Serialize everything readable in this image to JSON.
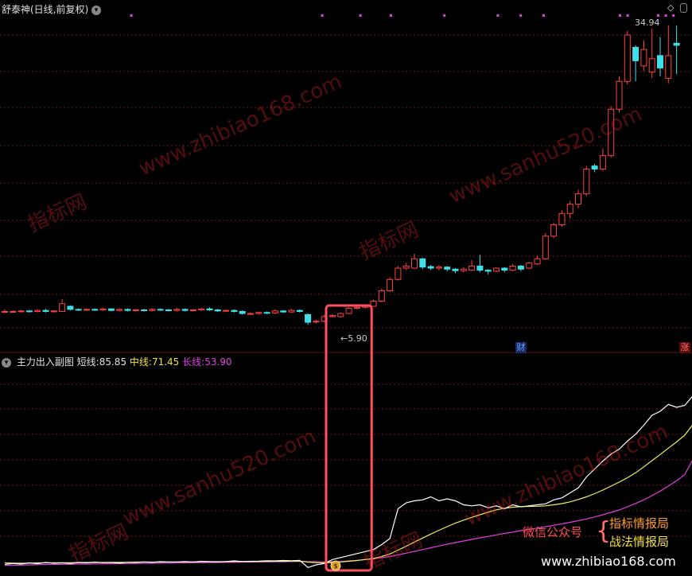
{
  "main_panel": {
    "title": "舒泰神(日线,前复权)",
    "price_high_label": "34.94",
    "price_low_label": "5.90",
    "event_badge_cai": "财",
    "event_badge_zhang": "涨"
  },
  "indicator_panel": {
    "title": "主力出入副图",
    "short_label": "短线:",
    "short_value": "85.85",
    "mid_label": "中线:",
    "mid_value": "71.45",
    "long_label": "长线:",
    "long_value": "53.90"
  },
  "watermarks": {
    "url1": "www.zhibiao168.com",
    "url2": "www.sanhu520.com",
    "site": "指标网"
  },
  "promo": {
    "left": "微信公众号",
    "right_line1": "指标情报局",
    "right_line2": "战法情报局",
    "bottom_url": "www.zhibiao168.com"
  },
  "colors": {
    "up": "#ff4040",
    "down": "#40e0e8",
    "short": "#ffffff",
    "mid": "#f0f060",
    "long": "#e040e0",
    "highlight": "#ff5060"
  },
  "chart_data": {
    "type": "candlestick",
    "price_range": [
      5.0,
      36.0
    ],
    "candles": [
      {
        "o": 7.2,
        "c": 7.2,
        "h": 7.4,
        "l": 7.05
      },
      {
        "o": 7.2,
        "c": 7.2,
        "h": 7.3,
        "l": 7.1
      },
      {
        "o": 7.2,
        "c": 7.25,
        "h": 7.35,
        "l": 7.1
      },
      {
        "o": 7.25,
        "c": 7.2,
        "h": 7.35,
        "l": 7.1
      },
      {
        "o": 7.2,
        "c": 7.3,
        "h": 7.4,
        "l": 7.1
      },
      {
        "o": 7.3,
        "c": 7.2,
        "h": 7.45,
        "l": 7.1
      },
      {
        "o": 7.2,
        "c": 7.25,
        "h": 7.35,
        "l": 7.1
      },
      {
        "o": 7.2,
        "c": 7.95,
        "h": 8.4,
        "l": 7.15
      },
      {
        "o": 7.7,
        "c": 7.4,
        "h": 7.8,
        "l": 7.3
      },
      {
        "o": 7.4,
        "c": 7.35,
        "h": 7.5,
        "l": 7.25
      },
      {
        "o": 7.35,
        "c": 7.4,
        "h": 7.5,
        "l": 7.25
      },
      {
        "o": 7.4,
        "c": 7.35,
        "h": 7.5,
        "l": 7.25
      },
      {
        "o": 7.35,
        "c": 7.45,
        "h": 7.55,
        "l": 7.25
      },
      {
        "o": 7.45,
        "c": 7.3,
        "h": 7.5,
        "l": 7.2
      },
      {
        "o": 7.3,
        "c": 7.4,
        "h": 7.5,
        "l": 7.2
      },
      {
        "o": 7.4,
        "c": 7.3,
        "h": 7.5,
        "l": 7.2
      },
      {
        "o": 7.3,
        "c": 7.35,
        "h": 7.45,
        "l": 7.2
      },
      {
        "o": 7.35,
        "c": 7.3,
        "h": 7.45,
        "l": 7.2
      },
      {
        "o": 7.3,
        "c": 7.4,
        "h": 7.5,
        "l": 7.2
      },
      {
        "o": 7.4,
        "c": 7.35,
        "h": 7.5,
        "l": 7.25
      },
      {
        "o": 7.35,
        "c": 7.3,
        "h": 7.45,
        "l": 7.2
      },
      {
        "o": 7.3,
        "c": 7.4,
        "h": 7.55,
        "l": 7.2
      },
      {
        "o": 7.4,
        "c": 7.3,
        "h": 7.5,
        "l": 7.2
      },
      {
        "o": 7.3,
        "c": 7.35,
        "h": 7.45,
        "l": 7.2
      },
      {
        "o": 7.35,
        "c": 7.45,
        "h": 7.55,
        "l": 7.25
      },
      {
        "o": 7.45,
        "c": 7.35,
        "h": 7.6,
        "l": 7.25
      },
      {
        "o": 7.35,
        "c": 7.25,
        "h": 7.45,
        "l": 7.15
      },
      {
        "o": 7.25,
        "c": 7.3,
        "h": 7.4,
        "l": 7.15
      },
      {
        "o": 7.3,
        "c": 7.2,
        "h": 7.4,
        "l": 7.1
      },
      {
        "o": 7.2,
        "c": 7.0,
        "h": 7.3,
        "l": 6.9
      },
      {
        "o": 6.95,
        "c": 7.0,
        "h": 7.1,
        "l": 6.85
      },
      {
        "o": 7.0,
        "c": 7.1,
        "h": 7.2,
        "l": 6.9
      },
      {
        "o": 7.1,
        "c": 7.05,
        "h": 7.2,
        "l": 6.95
      },
      {
        "o": 7.05,
        "c": 7.25,
        "h": 7.4,
        "l": 6.95
      },
      {
        "o": 7.25,
        "c": 7.15,
        "h": 7.35,
        "l": 7.05
      },
      {
        "o": 7.15,
        "c": 7.3,
        "h": 7.45,
        "l": 7.05
      },
      {
        "o": 7.3,
        "c": 7.2,
        "h": 7.4,
        "l": 7.1
      },
      {
        "o": 6.9,
        "c": 6.15,
        "h": 7.0,
        "l": 5.9
      },
      {
        "o": 6.2,
        "c": 6.25,
        "h": 6.4,
        "l": 6.05
      },
      {
        "o": 6.25,
        "c": 6.7,
        "h": 6.85,
        "l": 6.15
      },
      {
        "o": 6.7,
        "c": 6.8,
        "h": 6.95,
        "l": 6.6
      },
      {
        "o": 6.7,
        "c": 7.0,
        "h": 7.1,
        "l": 6.6
      },
      {
        "o": 7.0,
        "c": 7.5,
        "h": 7.6,
        "l": 6.95
      },
      {
        "o": 7.5,
        "c": 7.6,
        "h": 7.7,
        "l": 7.4
      },
      {
        "o": 7.6,
        "c": 7.7,
        "h": 7.85,
        "l": 7.5
      },
      {
        "o": 7.7,
        "c": 8.2,
        "h": 8.35,
        "l": 7.65
      },
      {
        "o": 8.2,
        "c": 9.2,
        "h": 9.4,
        "l": 8.1
      },
      {
        "o": 9.2,
        "c": 10.3,
        "h": 10.5,
        "l": 9.1
      },
      {
        "o": 10.3,
        "c": 11.4,
        "h": 11.6,
        "l": 10.2
      },
      {
        "o": 11.4,
        "c": 11.6,
        "h": 11.9,
        "l": 11.2
      },
      {
        "o": 11.4,
        "c": 12.3,
        "h": 12.8,
        "l": 11.3
      },
      {
        "o": 12.3,
        "c": 11.5,
        "h": 12.4,
        "l": 11.3
      },
      {
        "o": 11.55,
        "c": 11.4,
        "h": 11.7,
        "l": 11.2
      },
      {
        "o": 11.4,
        "c": 11.5,
        "h": 11.7,
        "l": 11.2
      },
      {
        "o": 11.5,
        "c": 11.3,
        "h": 11.6,
        "l": 11.1
      },
      {
        "o": 11.3,
        "c": 11.15,
        "h": 11.4,
        "l": 10.9
      },
      {
        "o": 11.15,
        "c": 11.3,
        "h": 11.5,
        "l": 11.0
      },
      {
        "o": 11.2,
        "c": 11.6,
        "h": 12.2,
        "l": 11.1
      },
      {
        "o": 11.6,
        "c": 11.2,
        "h": 12.7,
        "l": 11.0
      },
      {
        "o": 11.2,
        "c": 11.1,
        "h": 11.3,
        "l": 10.8
      },
      {
        "o": 11.1,
        "c": 11.4,
        "h": 11.5,
        "l": 11.0
      },
      {
        "o": 11.4,
        "c": 11.2,
        "h": 11.5,
        "l": 11.0
      },
      {
        "o": 11.2,
        "c": 11.6,
        "h": 11.8,
        "l": 11.1
      },
      {
        "o": 11.6,
        "c": 11.3,
        "h": 11.7,
        "l": 11.1
      },
      {
        "o": 11.4,
        "c": 11.9,
        "h": 12.0,
        "l": 11.3
      },
      {
        "o": 11.8,
        "c": 12.3,
        "h": 12.6,
        "l": 11.7
      },
      {
        "o": 12.3,
        "c": 14.5,
        "h": 14.8,
        "l": 12.2
      },
      {
        "o": 14.5,
        "c": 15.6,
        "h": 15.8,
        "l": 14.3
      },
      {
        "o": 15.6,
        "c": 16.7,
        "h": 17.0,
        "l": 15.4
      },
      {
        "o": 16.7,
        "c": 17.6,
        "h": 17.9,
        "l": 16.2
      },
      {
        "o": 17.6,
        "c": 18.6,
        "h": 19.0,
        "l": 17.2
      },
      {
        "o": 18.6,
        "c": 21.0,
        "h": 21.3,
        "l": 18.4
      },
      {
        "o": 21.3,
        "c": 21.0,
        "h": 21.5,
        "l": 20.7
      },
      {
        "o": 21.0,
        "c": 22.3,
        "h": 23.0,
        "l": 20.8
      },
      {
        "o": 22.3,
        "c": 26.8,
        "h": 27.1,
        "l": 22.1
      },
      {
        "o": 26.8,
        "c": 29.5,
        "h": 30.0,
        "l": 26.5
      },
      {
        "o": 29.5,
        "c": 34.0,
        "h": 34.4,
        "l": 29.2
      },
      {
        "o": 32.8,
        "c": 31.5,
        "h": 33.0,
        "l": 29.5
      },
      {
        "o": 31.0,
        "c": 32.6,
        "h": 33.5,
        "l": 30.5
      },
      {
        "o": 30.4,
        "c": 31.7,
        "h": 34.6,
        "l": 29.8
      },
      {
        "o": 32.0,
        "c": 30.8,
        "h": 33.8,
        "l": 30.0
      },
      {
        "o": 29.8,
        "c": 32.0,
        "h": 34.94,
        "l": 29.3
      },
      {
        "o": 33.2,
        "c": 33.0,
        "h": 34.9,
        "l": 30.2
      }
    ],
    "indicator_range": [
      0,
      100
    ],
    "indicator": {
      "short": [
        1.0,
        1.5,
        1.2,
        1.8,
        1.4,
        2.0,
        1.6,
        1.8,
        1.5,
        2.0,
        1.8,
        2.2,
        1.9,
        2.0,
        1.7,
        2.1,
        2.0,
        2.3,
        2.1,
        2.4,
        2.2,
        2.3,
        2.5,
        2.2,
        2.6,
        2.4,
        2.3,
        2.5,
        2.8,
        2.5,
        2.6,
        2.7,
        2.9,
        2.8,
        3.0,
        2.9,
        3.1,
        -0.5,
        0.8,
        1.5,
        3.5,
        4.5,
        5.5,
        6.5,
        7.5,
        8.5,
        11.0,
        14.0,
        29.0,
        32.0,
        33.0,
        33.5,
        35.0,
        33.0,
        34.0,
        33.0,
        31.0,
        30.5,
        31.0,
        29.5,
        30.5,
        29.0,
        31.0,
        30.0,
        30.5,
        31.0,
        31.5,
        33.5,
        34.5,
        37.0,
        39.5,
        45.0,
        49.0,
        53.0,
        56.5,
        59.0,
        63.0,
        66.5,
        71.0,
        76.0,
        78.0,
        81.5,
        80.0,
        81.0,
        85.85
      ],
      "mid": [
        1.8,
        1.7,
        1.6,
        1.7,
        1.8,
        1.8,
        1.9,
        1.9,
        1.9,
        2.0,
        2.0,
        2.0,
        2.0,
        2.1,
        2.1,
        2.1,
        2.2,
        2.2,
        2.2,
        2.2,
        2.3,
        2.3,
        2.3,
        2.3,
        2.4,
        2.4,
        2.4,
        2.4,
        2.5,
        2.5,
        2.5,
        2.5,
        2.6,
        2.6,
        2.6,
        2.7,
        2.7,
        2.2,
        1.9,
        1.8,
        2.0,
        2.3,
        2.6,
        3.0,
        3.5,
        4.0,
        5.0,
        6.3,
        8.2,
        10.2,
        12.3,
        14.3,
        16.3,
        18.2,
        20.0,
        21.8,
        23.3,
        24.7,
        26.0,
        27.3,
        28.5,
        29.3,
        29.8,
        30.1,
        30.2,
        30.3,
        30.5,
        31.0,
        31.6,
        32.5,
        33.7,
        35.0,
        36.6,
        38.4,
        40.4,
        42.4,
        44.6,
        47.1,
        50.1,
        53.2,
        56.3,
        59.5,
        62.6,
        66.0,
        71.45
      ],
      "long": [
        0.5,
        0.6,
        0.7,
        0.8,
        0.9,
        1.0,
        1.0,
        1.1,
        1.1,
        1.2,
        1.2,
        1.3,
        1.3,
        1.4,
        1.4,
        1.5,
        1.5,
        1.6,
        1.6,
        1.7,
        1.7,
        1.8,
        1.8,
        1.9,
        1.9,
        2.0,
        2.0,
        2.1,
        2.1,
        2.2,
        2.2,
        2.3,
        2.3,
        2.4,
        2.4,
        2.5,
        2.5,
        2.4,
        2.4,
        2.3,
        2.4,
        2.5,
        2.8,
        3.1,
        3.5,
        3.9,
        4.4,
        5.0,
        5.8,
        6.7,
        7.6,
        8.5,
        9.4,
        10.3,
        11.2,
        12.0,
        12.8,
        13.6,
        14.4,
        15.1,
        15.9,
        16.6,
        17.3,
        18.0,
        18.7,
        19.3,
        20.0,
        20.7,
        21.4,
        22.2,
        23.0,
        23.9,
        24.9,
        26.0,
        27.2,
        28.4,
        30.0,
        31.7,
        33.5,
        35.6,
        37.9,
        40.4,
        43.1,
        46.2,
        53.9
      ]
    },
    "highlight_candle_range": [
      40,
      44
    ],
    "cai_badge_index": 63,
    "zhang_badge_index": 83,
    "low_label_index": 40,
    "money_icon_index": 40
  }
}
